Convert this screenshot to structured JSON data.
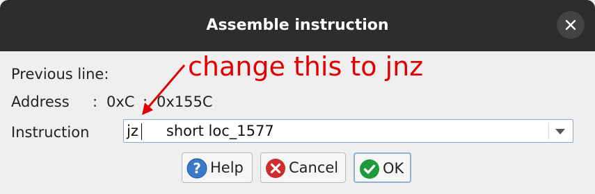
{
  "dialog": {
    "title": "Assemble instruction"
  },
  "form": {
    "previous_line_label": "Previous line:",
    "address_label": "Address",
    "address_sep1": ":",
    "address_segment": "0xC",
    "address_sep2": ":",
    "address_offset": "0x155C",
    "instruction_label": "Instruction",
    "instruction_value": "jz      short loc_1577"
  },
  "buttons": {
    "help": "Help",
    "cancel": "Cancel",
    "ok": "OK"
  },
  "annotation": {
    "text": "change this to jnz",
    "color": "#e00000"
  },
  "icons": {
    "close": "close-icon",
    "help": "help-icon",
    "cancel": "cancel-icon",
    "ok": "check-icon",
    "dropdown": "chevron-down-icon"
  }
}
